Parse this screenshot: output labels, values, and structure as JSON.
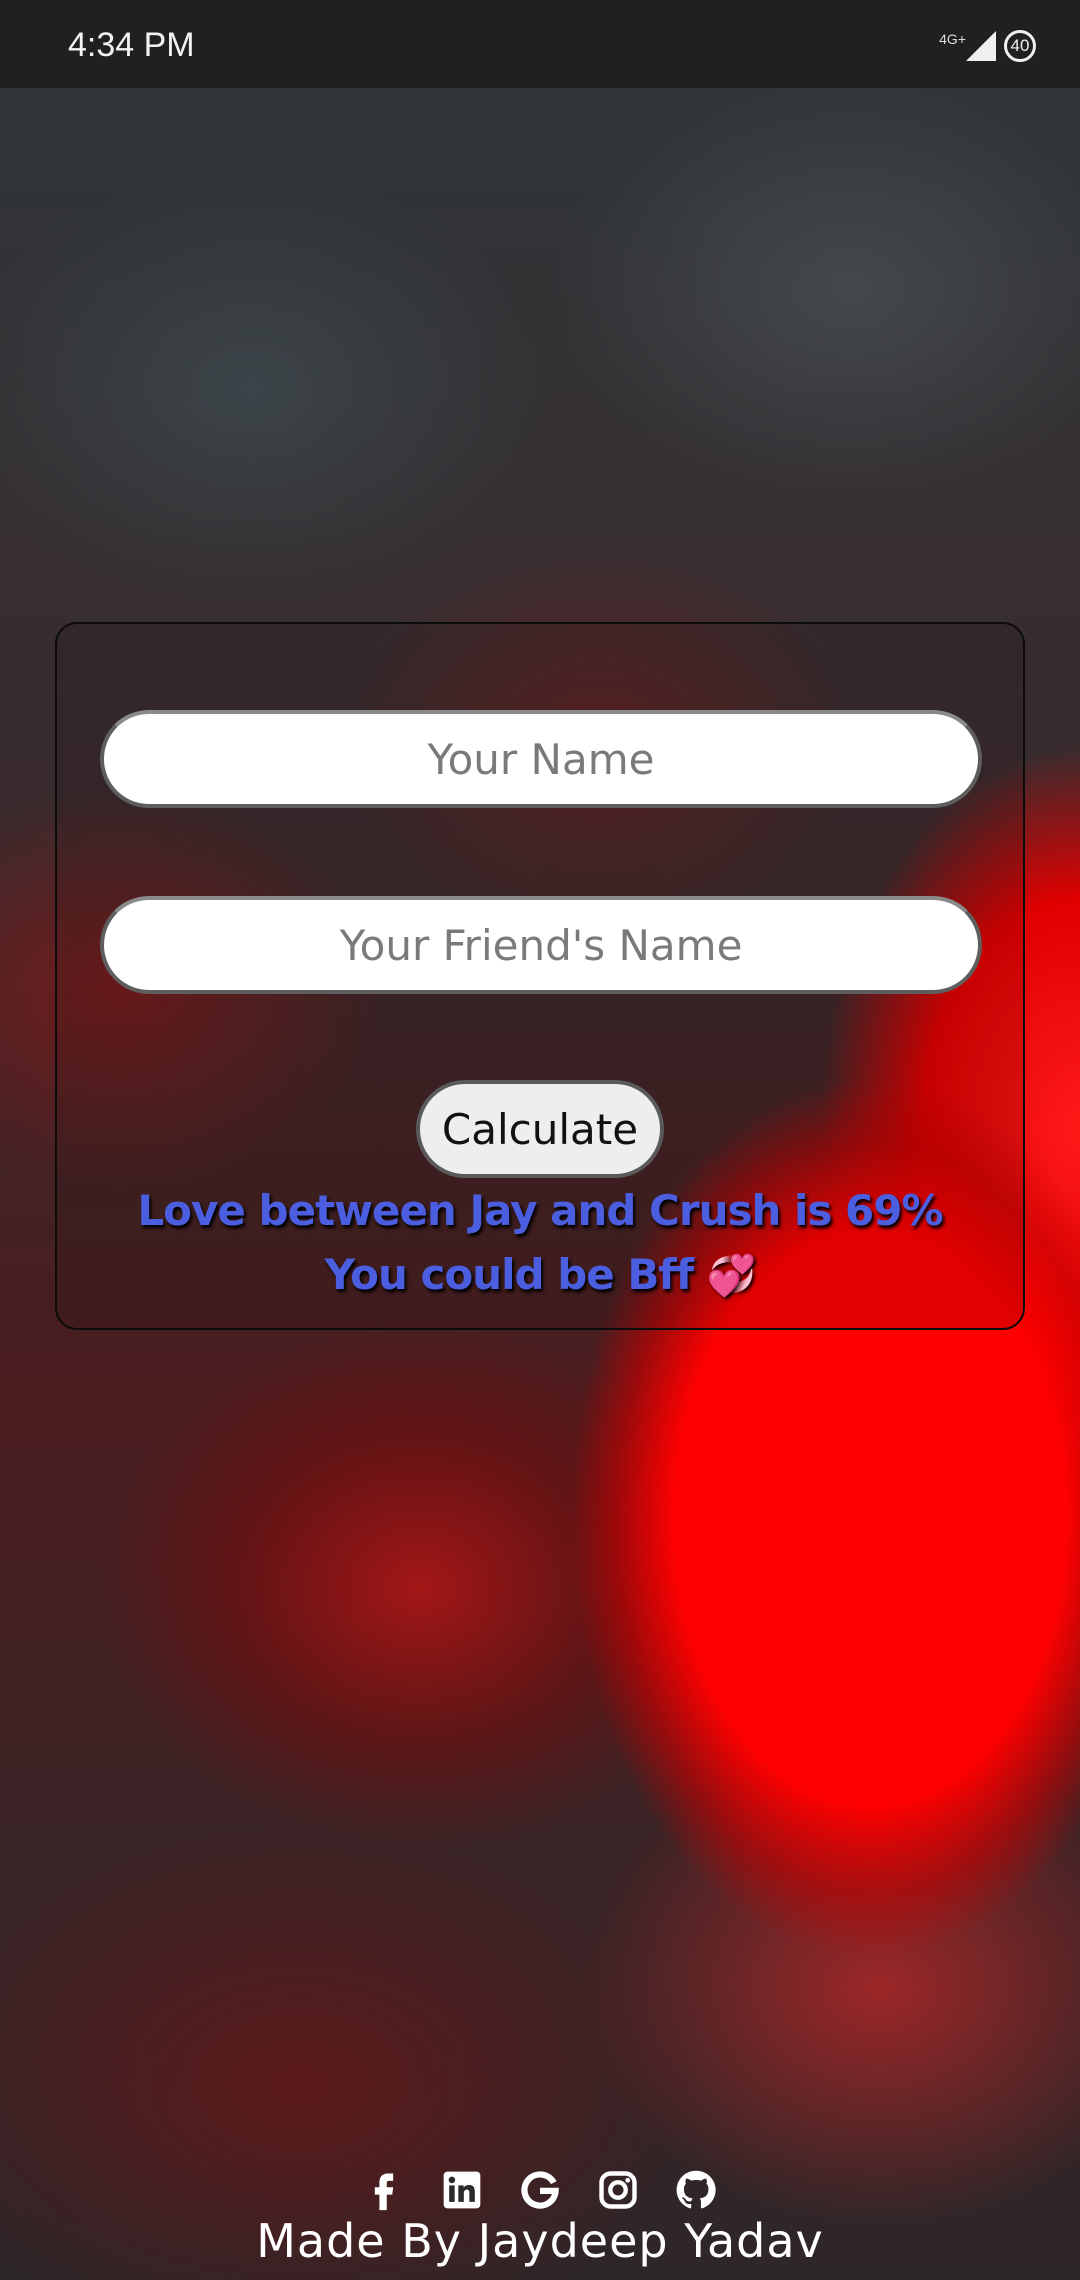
{
  "status_bar": {
    "time": "4:34 PM",
    "network": "4G+",
    "battery": "40"
  },
  "form": {
    "name_placeholder": "Your Name",
    "friend_placeholder": "Your Friend's Name",
    "calculate_label": "Calculate"
  },
  "result": {
    "line1": "Love between Jay and Crush is 69%",
    "line2": "You could be Bff",
    "emoji": "💞"
  },
  "footer": {
    "social_icons": [
      "facebook-icon",
      "linkedin-icon",
      "google-icon",
      "instagram-icon",
      "github-icon"
    ],
    "credit": "Made By Jaydeep Yadav"
  },
  "colors": {
    "result_text": "#4b5ee0",
    "status_bar": "#202020",
    "accent_red": "#ff0000"
  }
}
